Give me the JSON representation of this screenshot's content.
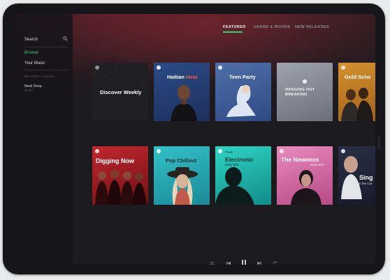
{
  "sidebar": {
    "search_label": "Search",
    "nav": [
      {
        "label": "Browse",
        "active": true
      },
      {
        "label": "Your Music",
        "active": false
      }
    ],
    "recently_played_title": "RECENTLY PLAYED",
    "recent": [
      {
        "title": "Neck Deep",
        "subtitle": "ARTIST"
      }
    ]
  },
  "tabs": [
    {
      "label": "FEATURED",
      "active": true
    },
    {
      "label": "GENRE & MOODS",
      "active": false
    },
    {
      "label": "NEW RELEASES",
      "active": false
    }
  ],
  "playlists_row1": [
    {
      "name": "Discover Weekly",
      "sub": ""
    },
    {
      "name": "Haitian",
      "accent": "Heat",
      "sub": ""
    },
    {
      "name": "Teen Party",
      "sub": ""
    },
    {
      "name": "HANGING OUT\nBREAKING",
      "sub": ""
    },
    {
      "name": "Gold Scho",
      "sub": ""
    }
  ],
  "playlists_row2": [
    {
      "name": "Digging Now",
      "sub": ""
    },
    {
      "name": "Pop Chillout",
      "sub": ""
    },
    {
      "name": "Electronic",
      "pre": "Fresh",
      "sub": "Early Bird"
    },
    {
      "name": "The Newness",
      "sub": "Early Bird"
    },
    {
      "name": "Sing",
      "sub": "in the Car"
    }
  ],
  "colors": {
    "accent_green": "#2bd66e",
    "text_primary": "#f2f2f4",
    "text_secondary": "#8d8d94"
  },
  "player": {
    "icons": [
      "shuffle-icon",
      "previous-icon",
      "pause-icon",
      "next-icon",
      "repeat-icon"
    ]
  }
}
